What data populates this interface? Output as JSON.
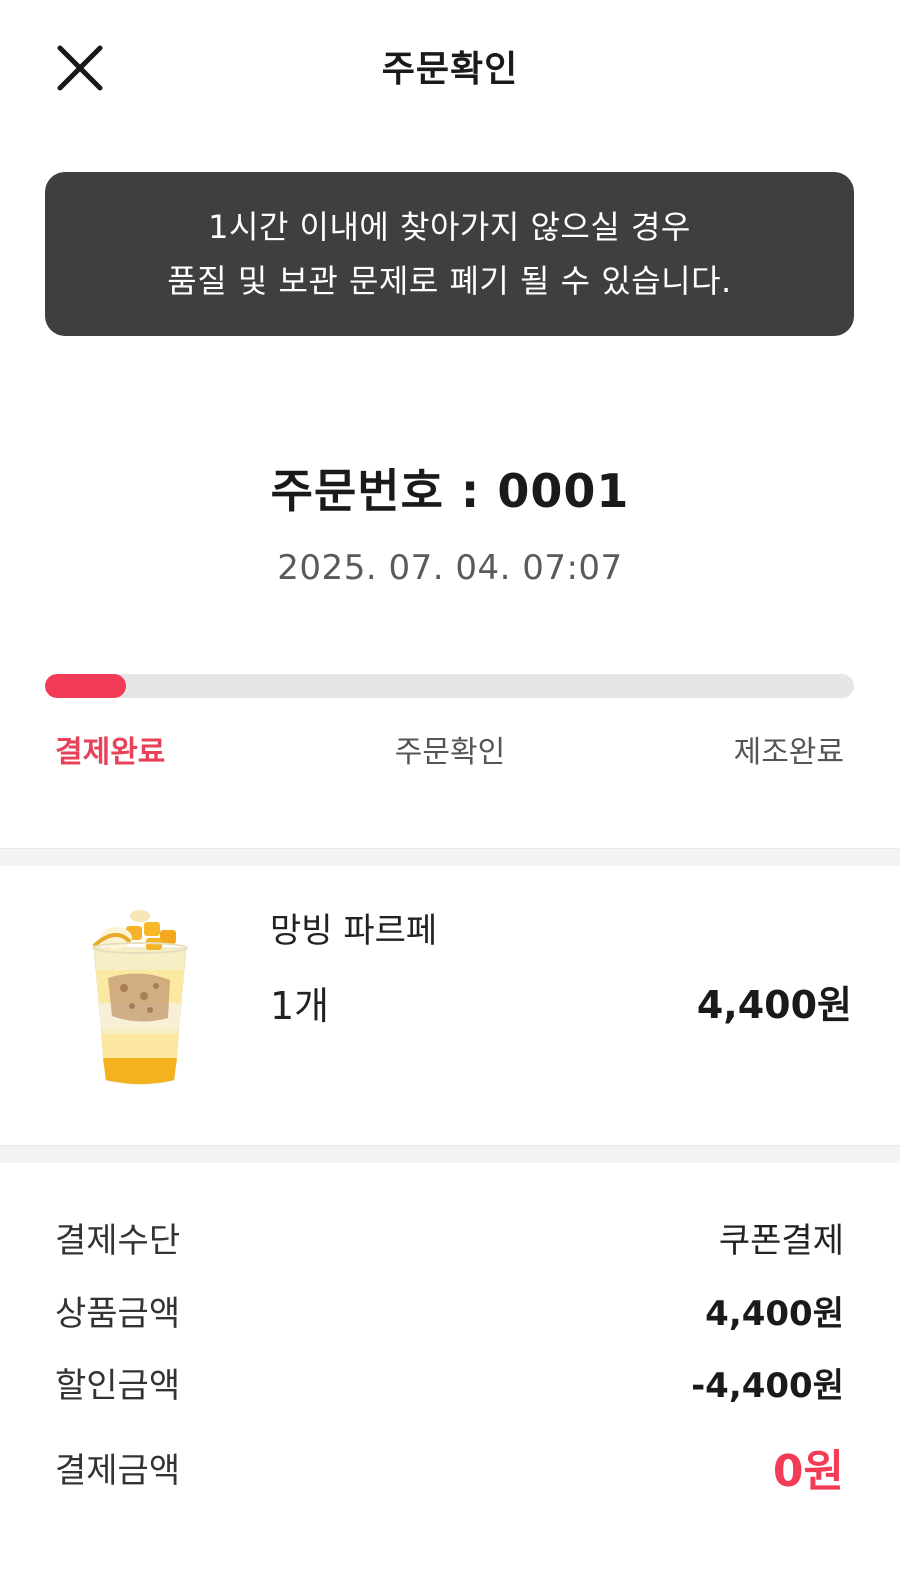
{
  "header": {
    "title": "주문확인"
  },
  "notice": {
    "line1": "1시간 이내에 찾아가지 않으실 경우",
    "line2": "품질 및 보관 문제로 폐기 될 수 있습니다."
  },
  "order": {
    "number": "주문번호 : 0001",
    "datetime": "2025. 07. 04. 07:07"
  },
  "progress": {
    "fraction": 0.1,
    "steps": [
      {
        "label": "결제완료",
        "active": true
      },
      {
        "label": "주문확인",
        "active": false
      },
      {
        "label": "제조완료",
        "active": false
      }
    ]
  },
  "product": {
    "name": "망빙 파르페",
    "quantity": "1개",
    "price": "4,400원"
  },
  "payment": {
    "method": {
      "label": "결제수단",
      "value": "쿠폰결제"
    },
    "product_amount": {
      "label": "상품금액",
      "value": "4,400원"
    },
    "discount_amount": {
      "label": "할인금액",
      "value": "-4,400원"
    },
    "total_amount": {
      "label": "결제금액",
      "value": "0원"
    }
  },
  "colors": {
    "accent": "#f23c57",
    "notice_bg": "#3f3f3f"
  }
}
